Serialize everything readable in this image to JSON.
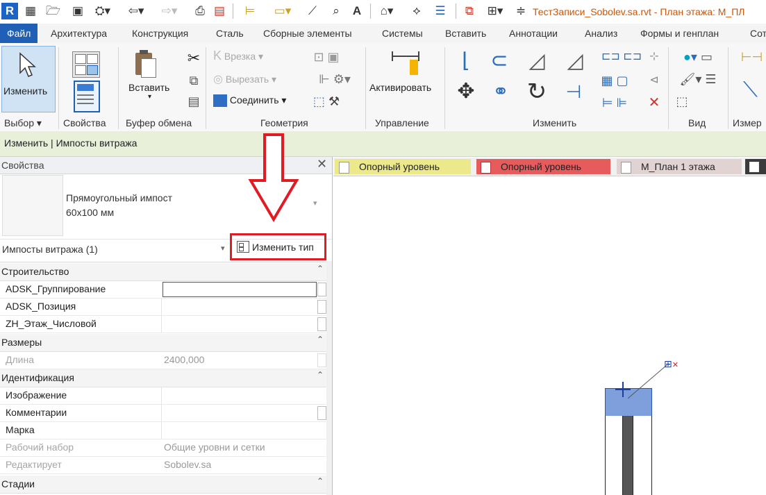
{
  "title_bar": {
    "title": "ТестЗаписи_Sobolev.sa.rvt - План этажа: М_ПЛ",
    "logo": "R"
  },
  "tabs": [
    "Файл",
    "Архитектура",
    "Конструкция",
    "Сталь",
    "Сборные элементы",
    "Системы",
    "Вставить",
    "Аннотации",
    "Анализ",
    "Формы и генплан",
    "Сот"
  ],
  "ribbon": {
    "modify": "Изменить",
    "paste": "Вставить",
    "cut_disabled": "Врезка",
    "cut_out_disabled": "Вырезать",
    "join": "Соединить",
    "activate": "Активировать",
    "panels": {
      "select": "Выбор",
      "properties": "Свойства",
      "clipboard": "Буфер обмена",
      "geometry": "Геометрия",
      "control": "Управление",
      "modify": "Изменить",
      "view": "Вид",
      "measure": "Измер"
    }
  },
  "context_bar": "Изменить | Импосты витража",
  "properties": {
    "header": "Свойства",
    "type_name_line1": "Прямоугольный импост",
    "type_name_line2": "60x100 мм",
    "instance_filter": "Импосты витража (1)",
    "edit_type": "Изменить тип",
    "categories": {
      "construction": "Строительство",
      "dimensions": "Размеры",
      "identity": "Идентификация",
      "phasing": "Стадии"
    },
    "rows": {
      "grouping": "ADSK_Группирование",
      "position": "ADSK_Позиция",
      "floor": "ZH_Этаж_Числовой",
      "length": "Длина",
      "length_value": "2400,000",
      "image": "Изображение",
      "comments": "Комментарии",
      "mark": "Марка",
      "workset": "Рабочий набор",
      "workset_value": "Общие уровни и сетки",
      "edited_by": "Редактирует",
      "edited_by_value": "Sobolev.sa"
    }
  },
  "view_tabs": [
    "Опорный уровень",
    "Опорный уровень",
    "М_План 1 этажа"
  ],
  "colors": {
    "accent_blue": "#1f5fb5",
    "title_orange": "#d35400",
    "highlight_red": "#e01b24",
    "selected_mullion": "#7f9edc"
  }
}
